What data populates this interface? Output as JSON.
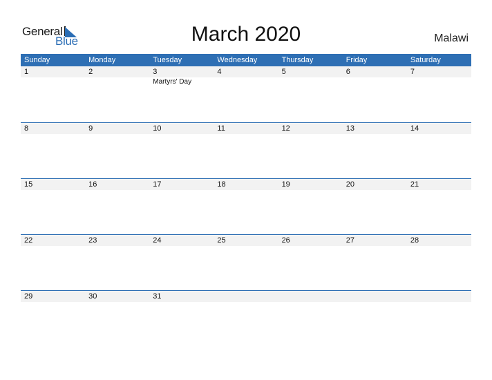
{
  "logo": {
    "word1": "General",
    "word2": "Blue"
  },
  "title": "March 2020",
  "country": "Malawi",
  "colors": {
    "accent": "#2e6fb4",
    "row_bg": "#f2f2f2"
  },
  "weekdays": [
    "Sunday",
    "Monday",
    "Tuesday",
    "Wednesday",
    "Thursday",
    "Friday",
    "Saturday"
  ],
  "weeks": [
    {
      "days": [
        "1",
        "2",
        "3",
        "4",
        "5",
        "6",
        "7"
      ],
      "events": [
        "",
        "",
        "Martyrs' Day",
        "",
        "",
        "",
        ""
      ]
    },
    {
      "days": [
        "8",
        "9",
        "10",
        "11",
        "12",
        "13",
        "14"
      ],
      "events": [
        "",
        "",
        "",
        "",
        "",
        "",
        ""
      ]
    },
    {
      "days": [
        "15",
        "16",
        "17",
        "18",
        "19",
        "20",
        "21"
      ],
      "events": [
        "",
        "",
        "",
        "",
        "",
        "",
        ""
      ]
    },
    {
      "days": [
        "22",
        "23",
        "24",
        "25",
        "26",
        "27",
        "28"
      ],
      "events": [
        "",
        "",
        "",
        "",
        "",
        "",
        ""
      ]
    },
    {
      "days": [
        "29",
        "30",
        "31",
        "",
        "",
        "",
        ""
      ],
      "events": [
        "",
        "",
        "",
        "",
        "",
        "",
        ""
      ]
    }
  ]
}
